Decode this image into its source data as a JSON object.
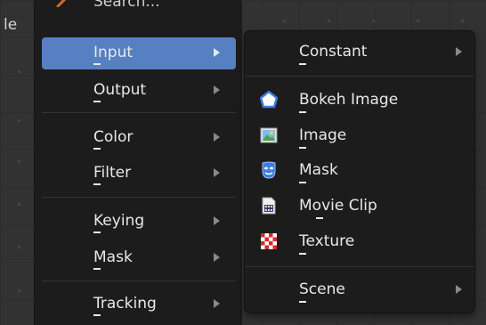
{
  "header_fragment": "le",
  "search": {
    "label": "Search..."
  },
  "main_menu": {
    "items": [
      {
        "label": "Input",
        "active": true
      },
      {
        "label": "Output"
      },
      {
        "label": "Color"
      },
      {
        "label": "Filter"
      },
      {
        "label": "Keying"
      },
      {
        "label": "Mask"
      },
      {
        "label": "Tracking"
      }
    ]
  },
  "input_submenu": {
    "items": [
      {
        "label": "Constant",
        "icon": "none",
        "has_submenu": true
      },
      {
        "label": "Bokeh Image",
        "icon": "bokeh-icon"
      },
      {
        "label": "Image",
        "icon": "image-icon"
      },
      {
        "label": "Mask",
        "icon": "mask-icon"
      },
      {
        "label": "Movie Clip",
        "icon": "movie-clip-icon"
      },
      {
        "label": "Texture",
        "icon": "texture-icon"
      },
      {
        "label": "Scene",
        "icon": "none",
        "has_submenu": true
      }
    ]
  },
  "colors": {
    "menu_bg": "#1c1c1c",
    "highlight": "#5680c2",
    "text": "#e8e8e8"
  }
}
